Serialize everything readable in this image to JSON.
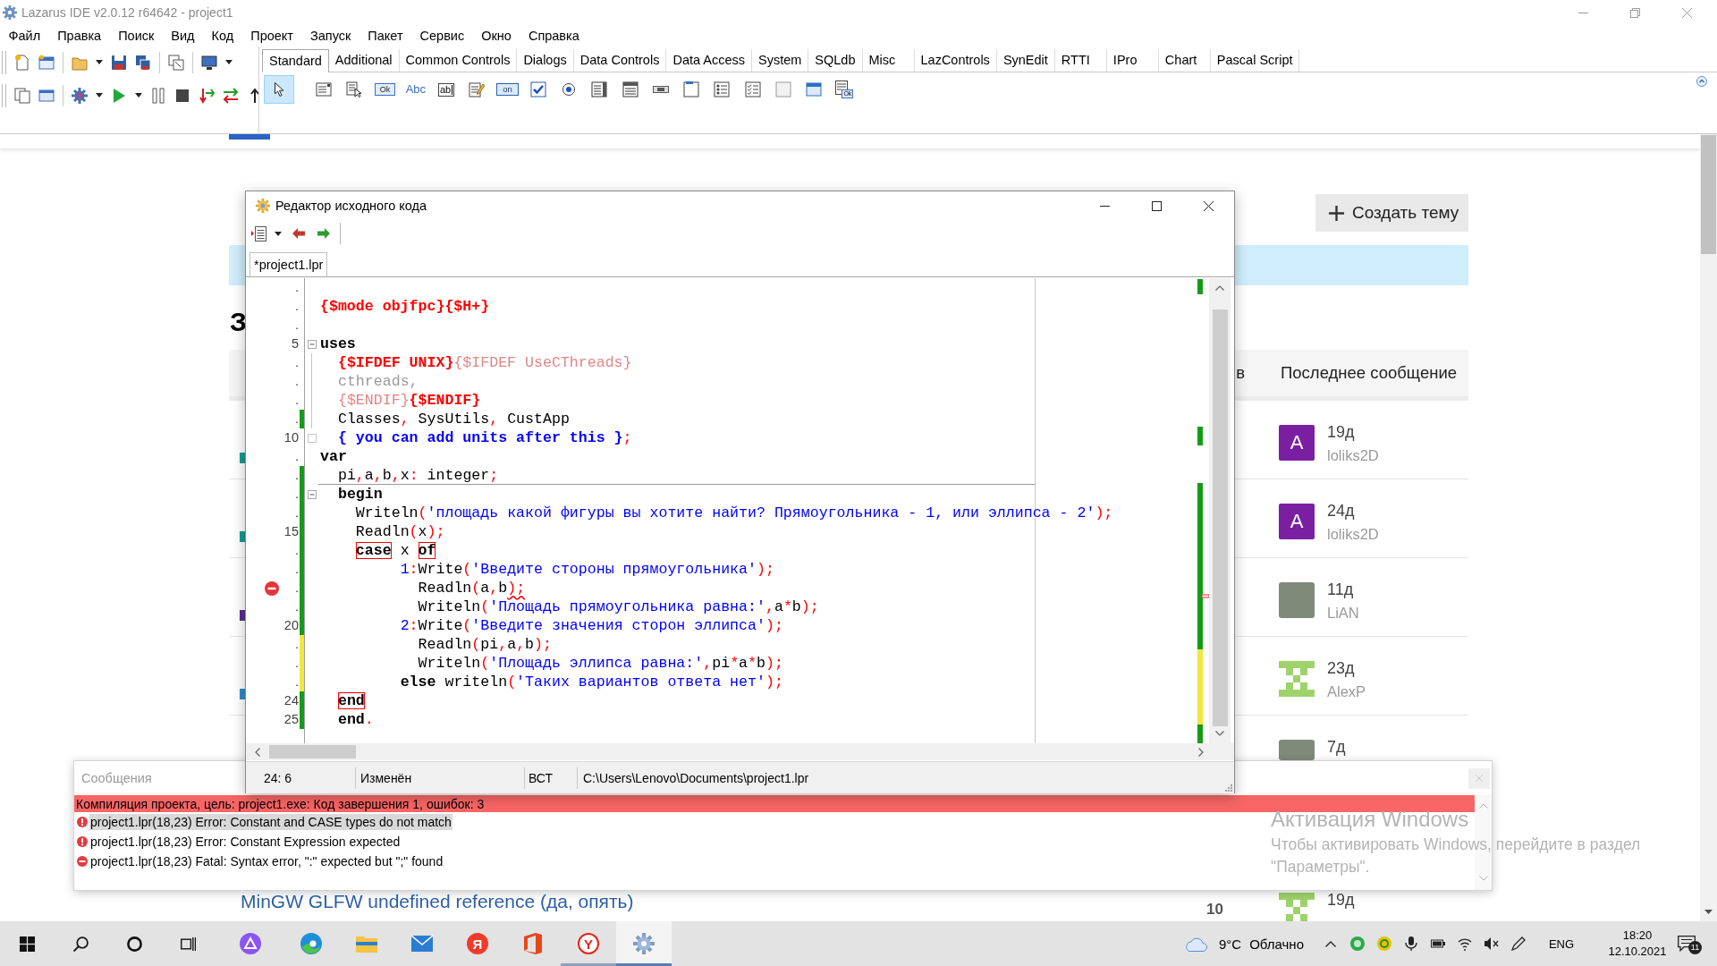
{
  "ide": {
    "title": "Lazarus IDE v2.0.12 r64642 - project1",
    "menu": [
      "Файл",
      "Правка",
      "Поиск",
      "Вид",
      "Код",
      "Проект",
      "Запуск",
      "Пакет",
      "Сервис",
      "Окно",
      "Справка"
    ],
    "palette_tabs": [
      {
        "label": "Standard",
        "selected": true
      },
      {
        "label": "Additional",
        "selected": false
      },
      {
        "label": "Common Controls",
        "selected": false
      },
      {
        "label": "Dialogs",
        "selected": false
      },
      {
        "label": "Data Controls",
        "selected": false
      },
      {
        "label": "Data Access",
        "selected": false
      },
      {
        "label": "System",
        "selected": false
      },
      {
        "label": "SQLdb",
        "selected": false
      },
      {
        "label": "Misc",
        "selected": false
      },
      {
        "label": "LazControls",
        "selected": false
      },
      {
        "label": "SynEdit",
        "selected": false
      },
      {
        "label": "RTTI",
        "selected": false
      },
      {
        "label": "IPro",
        "selected": false
      },
      {
        "label": "Chart",
        "selected": false
      },
      {
        "label": "Pascal Script",
        "selected": false
      }
    ],
    "palette_items": [
      {
        "kind": "pointer",
        "selected": true
      },
      {
        "kind": "mainmenu",
        "selected": false
      },
      {
        "kind": "popupmenu",
        "selected": false
      },
      {
        "kind": "button",
        "text": "Ok",
        "selected": false
      },
      {
        "kind": "label",
        "text": "Abc",
        "selected": false
      },
      {
        "kind": "edit",
        "text": "ab",
        "selected": false
      },
      {
        "kind": "memo",
        "selected": false
      },
      {
        "kind": "toggle",
        "text": "on",
        "selected": false
      },
      {
        "kind": "checkbox",
        "selected": false
      },
      {
        "kind": "radio",
        "selected": false
      },
      {
        "kind": "listbox",
        "selected": false
      },
      {
        "kind": "combobox",
        "selected": false
      },
      {
        "kind": "scrollbar",
        "selected": false
      },
      {
        "kind": "groupbox",
        "selected": false
      },
      {
        "kind": "radiogroup",
        "selected": false
      },
      {
        "kind": "checkgroup",
        "selected": false
      },
      {
        "kind": "panel",
        "selected": false
      },
      {
        "kind": "frame",
        "selected": false
      },
      {
        "kind": "actionlist",
        "text": "Ok",
        "selected": false
      }
    ]
  },
  "forum": {
    "new_topic_button": "Создать тему",
    "heading": "З",
    "columns": {
      "column_3": "в",
      "last_post": "Последнее сообщение"
    },
    "rows": [
      {
        "color": "#149b93",
        "avatar": {
          "kind": "letter",
          "text": "A"
        },
        "age": "19д",
        "author": "loliks2D"
      },
      {
        "color": "#149b93",
        "avatar": {
          "kind": "letter",
          "text": "A"
        },
        "age": "24д",
        "author": "loliks2D"
      },
      {
        "color": "#5b2d8c",
        "avatar": {
          "kind": "photo"
        },
        "age": "11д",
        "author": "LiAN"
      },
      {
        "color": "#2e8dcc",
        "avatar": {
          "kind": "identicon"
        },
        "age": "23д",
        "author": "AlexP"
      },
      {
        "avatar": {
          "kind": "photo"
        },
        "age": "7д"
      }
    ],
    "next_topic": {
      "title": "MinGW GLFW undefined reference (да, опять)",
      "replies": "10",
      "avatar": {
        "kind": "identicon"
      },
      "age": "19д"
    }
  },
  "editor": {
    "title": "Редактор исходного кода",
    "tabs": [
      {
        "label": "*project1.lpr",
        "selected": true
      }
    ],
    "lines": [
      {
        "number": ".",
        "divider": false,
        "error": false
      },
      {
        "number": ".",
        "divider": false,
        "error": false,
        "tokens": [
          {
            "text": "{$mode objfpc}{$H+}",
            "kind": "directive"
          }
        ]
      },
      {
        "number": ".",
        "divider": false,
        "error": false
      },
      {
        "number": "5",
        "divider": false,
        "error": false,
        "fold": {
          "kind": "start",
          "expanded": true
        },
        "tokens": [
          {
            "text": "uses",
            "kind": "keyword"
          }
        ]
      },
      {
        "number": ".",
        "divider": false,
        "error": false,
        "fold": {
          "kind": "line"
        },
        "tokens": [
          {
            "text": "  {$IFDEF UNIX}",
            "kind": "directive"
          },
          {
            "text": "{$IFDEF UseCThreads}",
            "kind": "disabled"
          }
        ]
      },
      {
        "number": ".",
        "divider": false,
        "error": false,
        "fold": {
          "kind": "line"
        },
        "tokens": [
          {
            "text": "  cthreads,",
            "kind": "inactive"
          }
        ]
      },
      {
        "number": ".",
        "divider": false,
        "error": false,
        "fold": {
          "kind": "line"
        },
        "tokens": [
          {
            "text": "  {$ENDIF}",
            "kind": "disabled"
          },
          {
            "text": "{$ENDIF}",
            "kind": "directive"
          }
        ]
      },
      {
        "number": ".",
        "color": "#179b17",
        "divider": false,
        "error": false,
        "fold": {
          "kind": "line"
        },
        "tokens": [
          {
            "text": "  Classes",
            "kind": "ident"
          },
          {
            "text": ",",
            "kind": "symbol"
          },
          {
            "text": " SysUtils",
            "kind": "ident"
          },
          {
            "text": ",",
            "kind": "symbol"
          },
          {
            "text": " CustApp",
            "kind": "ident"
          }
        ]
      },
      {
        "number": "10",
        "divider": false,
        "error": false,
        "fold": {
          "kind": "end"
        },
        "tokens": [
          {
            "text": "  { you can add units after this }",
            "kind": "comment"
          },
          {
            "text": ";",
            "kind": "symbol"
          }
        ]
      },
      {
        "number": ".",
        "divider": false,
        "error": false,
        "tokens": [
          {
            "text": "var",
            "kind": "keyword"
          }
        ]
      },
      {
        "number": ".",
        "color": "#179b17",
        "divider": true,
        "error": false,
        "tokens": [
          {
            "text": "  pi",
            "kind": "ident"
          },
          {
            "text": ",",
            "kind": "symbol"
          },
          {
            "text": "a",
            "kind": "ident"
          },
          {
            "text": ",",
            "kind": "symbol"
          },
          {
            "text": "b",
            "kind": "ident"
          },
          {
            "text": ",",
            "kind": "symbol"
          },
          {
            "text": "x",
            "kind": "ident"
          },
          {
            "text": ":",
            "kind": "symbol"
          },
          {
            "text": " integer",
            "kind": "ident"
          },
          {
            "text": ";",
            "kind": "symbol"
          }
        ]
      },
      {
        "number": ".",
        "color": "#179b17",
        "divider": false,
        "error": false,
        "fold": {
          "kind": "start",
          "expanded": true
        },
        "tokens": [
          {
            "text": "  begin",
            "kind": "keyword"
          }
        ]
      },
      {
        "number": ".",
        "color": "#179b17",
        "divider": false,
        "error": false,
        "tokens": [
          {
            "text": "    Writeln",
            "kind": "ident"
          },
          {
            "text": "(",
            "kind": "symbol"
          },
          {
            "text": "'площадь какой фигуры вы хотите найти? Прямоугольника - 1, или эллипса - 2'",
            "kind": "string"
          },
          {
            "text": ");",
            "kind": "symbol"
          }
        ]
      },
      {
        "number": "15",
        "color": "#179b17",
        "divider": false,
        "error": false,
        "tokens": [
          {
            "text": "    Readln",
            "kind": "ident"
          },
          {
            "text": "(",
            "kind": "symbol"
          },
          {
            "text": "x",
            "kind": "ident"
          },
          {
            "text": ");",
            "kind": "symbol"
          }
        ]
      },
      {
        "number": ".",
        "color": "#179b17",
        "divider": false,
        "error": false,
        "tokens": [
          {
            "text": "    case",
            "kind": "matched"
          },
          {
            "text": " x ",
            "kind": "ident"
          },
          {
            "text": "of",
            "kind": "matched"
          }
        ]
      },
      {
        "number": ".",
        "color": "#179b17",
        "divider": false,
        "error": false,
        "tokens": [
          {
            "text": "         1",
            "kind": "number"
          },
          {
            "text": ":",
            "kind": "symbol"
          },
          {
            "text": "Write",
            "kind": "ident"
          },
          {
            "text": "(",
            "kind": "symbol"
          },
          {
            "text": "'Введите стороны прямоугольника'",
            "kind": "string"
          },
          {
            "text": ");",
            "kind": "symbol"
          }
        ]
      },
      {
        "number": ".",
        "color": "#179b17",
        "divider": false,
        "error": true,
        "tokens": [
          {
            "text": "           Readln",
            "kind": "ident"
          },
          {
            "text": "(",
            "kind": "symbol"
          },
          {
            "text": "a",
            "kind": "ident"
          },
          {
            "text": ",",
            "kind": "symbol"
          },
          {
            "text": "b",
            "kind": "ident"
          },
          {
            "text": ");",
            "kind": "error"
          }
        ]
      },
      {
        "number": ".",
        "color": "#179b17",
        "divider": false,
        "error": false,
        "tokens": [
          {
            "text": "           Writeln",
            "kind": "ident"
          },
          {
            "text": "(",
            "kind": "symbol"
          },
          {
            "text": "'Площадь прямоугольника равна:'",
            "kind": "string"
          },
          {
            "text": ",",
            "kind": "symbol"
          },
          {
            "text": "a",
            "kind": "ident"
          },
          {
            "text": "*",
            "kind": "symbol"
          },
          {
            "text": "b",
            "kind": "ident"
          },
          {
            "text": ");",
            "kind": "symbol"
          }
        ]
      },
      {
        "number": "20",
        "color": "#179b17",
        "divider": false,
        "error": false,
        "tokens": [
          {
            "text": "         2",
            "kind": "number"
          },
          {
            "text": ":",
            "kind": "symbol"
          },
          {
            "text": "Write",
            "kind": "ident"
          },
          {
            "text": "(",
            "kind": "symbol"
          },
          {
            "text": "'Введите значения сторон эллипса'",
            "kind": "string"
          },
          {
            "text": ");",
            "kind": "symbol"
          }
        ]
      },
      {
        "number": ".",
        "color": "#f2e640",
        "divider": false,
        "error": false,
        "tokens": [
          {
            "text": "           Readln",
            "kind": "ident"
          },
          {
            "text": "(",
            "kind": "symbol"
          },
          {
            "text": "pi",
            "kind": "ident"
          },
          {
            "text": ",",
            "kind": "symbol"
          },
          {
            "text": "a",
            "kind": "ident"
          },
          {
            "text": ",",
            "kind": "symbol"
          },
          {
            "text": "b",
            "kind": "ident"
          },
          {
            "text": ");",
            "kind": "symbol"
          }
        ]
      },
      {
        "number": ".",
        "color": "#f2e640",
        "divider": false,
        "error": false,
        "tokens": [
          {
            "text": "           Writeln",
            "kind": "ident"
          },
          {
            "text": "(",
            "kind": "symbol"
          },
          {
            "text": "'Площадь эллипса равна:'",
            "kind": "string"
          },
          {
            "text": ",",
            "kind": "symbol"
          },
          {
            "text": "pi",
            "kind": "ident"
          },
          {
            "text": "*",
            "kind": "symbol"
          },
          {
            "text": "a",
            "kind": "ident"
          },
          {
            "text": "*",
            "kind": "symbol"
          },
          {
            "text": "b",
            "kind": "ident"
          },
          {
            "text": ");",
            "kind": "symbol"
          }
        ]
      },
      {
        "number": ".",
        "color": "#f2e640",
        "divider": false,
        "error": false,
        "tokens": [
          {
            "text": "         else",
            "kind": "keyword"
          },
          {
            "text": " writeln",
            "kind": "ident"
          },
          {
            "text": "(",
            "kind": "symbol"
          },
          {
            "text": "'Таких вариантов ответа нет'",
            "kind": "string"
          },
          {
            "text": ");",
            "kind": "symbol"
          }
        ]
      },
      {
        "number": "24",
        "color": "#179b17",
        "divider": false,
        "error": false,
        "tokens": [
          {
            "text": "  end",
            "kind": "matched"
          }
        ]
      },
      {
        "number": "25",
        "color": "#179b17",
        "divider": false,
        "error": false,
        "tokens": [
          {
            "text": "  end",
            "kind": "keyword"
          },
          {
            "text": ".",
            "kind": "symbol"
          }
        ]
      }
    ],
    "status": {
      "position": "24: 6",
      "modified": "Изменён",
      "mode": "ВСТ",
      "path": "C:\\Users\\Lenovo\\Documents\\project1.lpr"
    }
  },
  "messages": {
    "title": "Сообщения",
    "items": [
      {
        "kind": "summary",
        "text": "Компиляция проекта, цель: project1.exe: Код завершения 1, ошибок: 3",
        "selected": false
      },
      {
        "kind": "error",
        "text": "project1.lpr(18,23) Error: Constant and CASE types do not match",
        "selected": true
      },
      {
        "kind": "error",
        "text": "project1.lpr(18,23) Error: Constant Expression expected",
        "selected": false
      },
      {
        "kind": "fatal",
        "text": "project1.lpr(18,23) Fatal: Syntax error, \":\" expected but \";\" found",
        "selected": false
      }
    ]
  },
  "activation_notice": {
    "title": "Активация Windows",
    "text": "Чтобы активировать Windows, перейдите в раздел \"Параметры\"."
  },
  "taskbar": {
    "apps": [
      {
        "kind": "assistant",
        "running": false,
        "selected": false
      },
      {
        "kind": "edge",
        "running": false,
        "selected": false
      },
      {
        "kind": "explorer",
        "running": false,
        "selected": false
      },
      {
        "kind": "mail",
        "running": false,
        "selected": false
      },
      {
        "kind": "yandex",
        "glyph": "Я",
        "running": false,
        "selected": false
      },
      {
        "kind": "office",
        "running": false,
        "selected": false
      },
      {
        "kind": "yabrowser",
        "glyph": "Y",
        "running": true,
        "selected": false
      },
      {
        "kind": "lazarus",
        "running": true,
        "selected": true
      }
    ],
    "temperature": "9°C",
    "weather": "Облачно",
    "language": "ENG",
    "time": "18:20",
    "date": "12.10.2021",
    "notifications": "11"
  }
}
